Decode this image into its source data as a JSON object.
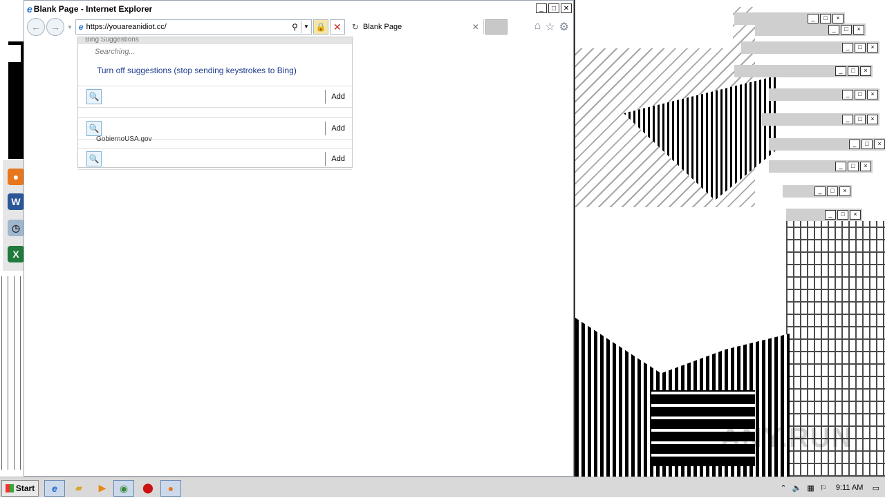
{
  "window": {
    "title": "Blank Page - Internet Explorer",
    "address_url": "https://youareanidiot.cc/",
    "tab_label": "Blank Page",
    "title_buttons": [
      "_",
      "□",
      "✕"
    ]
  },
  "suggestions": {
    "header": "Bing Suggestions",
    "status": "Searching...",
    "turn_off": "Turn off suggestions (stop sending keystrokes to Bing)",
    "providers": [
      {
        "add_label": "Add"
      },
      {
        "add_label": "Add"
      },
      {
        "add_label": "Add"
      }
    ],
    "partial_text": "GobiernoUSA.gov"
  },
  "taskbar": {
    "start_label": "Start",
    "clock": "9:11 AM"
  },
  "watermark": "ANY.RUN",
  "colors": {
    "ie_blue": "#1e6fd0",
    "link_blue": "#1a3a8c",
    "taskbar_bg": "#d9d9d9"
  },
  "icons": [
    "ie-icon",
    "firefox-icon",
    "word-icon",
    "clock-icon",
    "excel-icon",
    "folder-icon",
    "media-icon",
    "chrome-icon",
    "opera-icon"
  ]
}
